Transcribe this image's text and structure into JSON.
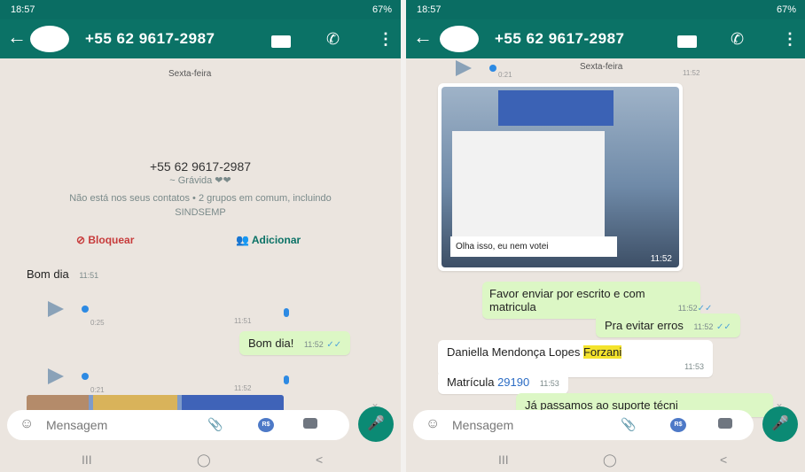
{
  "left": {
    "status": {
      "time": "18:57",
      "battery": "67%"
    },
    "appbar": {
      "back_icon": "arrow-left-icon",
      "title": "+55 62 9617-2987",
      "icons": [
        "video-icon",
        "phone-icon",
        "more-vert-icon"
      ]
    },
    "day": "Sexta-feira",
    "profile": {
      "phone": "+55 62 9617-2987",
      "nickname": "~ Grávida ❤❤",
      "info": "Não está nos seus contatos • 2 grupos em comum, incluindo SINDSEMP"
    },
    "actions": {
      "block": "Bloquear",
      "add": "Adicionar"
    },
    "msg1": {
      "text": "Bom dia",
      "time": "11:51"
    },
    "voice1": {
      "duration": "0:25",
      "time": "11:51"
    },
    "msg2": {
      "text": "Bom dia!",
      "time": "11:52"
    },
    "voice2": {
      "duration": "0:21",
      "time": "11:52"
    },
    "input": {
      "placeholder": "Mensagem"
    },
    "nav": [
      "III",
      "◯",
      "<"
    ]
  },
  "right": {
    "status": {
      "time": "18:57",
      "battery": "67%"
    },
    "appbar": {
      "title": "+55 62 9617-2987"
    },
    "voice": {
      "duration": "0:21",
      "time": "11:52"
    },
    "day": "Sexta-feira",
    "image": {
      "caption": "Olha isso, eu nem votei",
      "time": "11:52"
    },
    "msg3": {
      "line1": "Favor enviar por escrito e com",
      "line2": "matricula",
      "time": "11:52"
    },
    "msg4": {
      "text": "Pra evitar erros",
      "time": "11:52"
    },
    "msg5": {
      "name_prefix": "Daniella Mendonça  Lopes ",
      "name_highlight": "Forzani",
      "time": "11:53"
    },
    "msg6": {
      "label": "Matrícula ",
      "number": "29190",
      "time": "11:53"
    },
    "msg7": {
      "text": "Já passamos ao suporte técni"
    },
    "input": {
      "placeholder": "Mensagem"
    },
    "nav": [
      "III",
      "◯",
      "<"
    ]
  }
}
